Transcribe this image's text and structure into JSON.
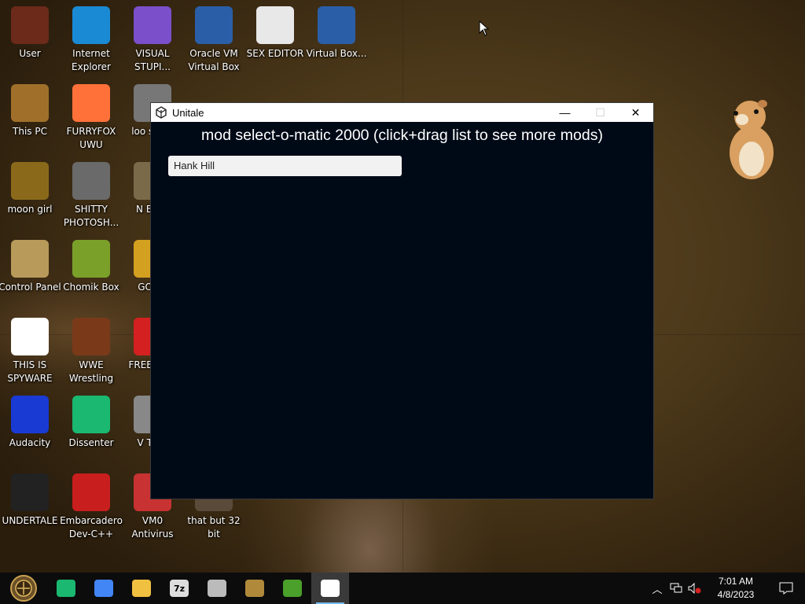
{
  "desktop": {
    "icons": [
      {
        "label": "User",
        "color": "#6b2a1a"
      },
      {
        "label": "Internet Explorer",
        "color": "#1a8ad4"
      },
      {
        "label": "VISUAL STUPI...",
        "color": "#7b4fc9"
      },
      {
        "label": "Oracle VM Virtual Box",
        "color": "#2a5fa8"
      },
      {
        "label": "SEX EDITOR",
        "color": "#e8e8e8"
      },
      {
        "label": "Virtual Box...",
        "color": "#2a5fa8"
      },
      {
        "label": "This PC",
        "color": "#a0702a"
      },
      {
        "label": "FURRYFOX UWU",
        "color": "#ff7139"
      },
      {
        "label": "loo skidd",
        "color": "#777777"
      },
      {
        "label": "moon girl",
        "color": "#8a6a1a"
      },
      {
        "label": "SHITTY PHOTOSH...",
        "color": "#6a6a6a"
      },
      {
        "label": "N Back",
        "color": "#7a6a4a"
      },
      {
        "label": "Control Panel",
        "color": "#b89a5a"
      },
      {
        "label": "Chomik Box",
        "color": "#7aa02a"
      },
      {
        "label": "GO Wi",
        "color": "#d4a020"
      },
      {
        "label": "THIS IS SPYWARE",
        "color": "#ffffff"
      },
      {
        "label": "WWE Wrestling",
        "color": "#7a3a1a"
      },
      {
        "label": "FREE GIFT",
        "color": "#d42020"
      },
      {
        "label": "Audacity",
        "color": "#1a3ad4"
      },
      {
        "label": "Dissenter",
        "color": "#1ab870"
      },
      {
        "label": "V Tech",
        "color": "#888888"
      },
      {
        "label": "UNDERTALE",
        "color": "#222222"
      },
      {
        "label": "Embarcadero Dev-C++",
        "color": "#c81e1e"
      },
      {
        "label": "VM0 Antivirus",
        "color": "#c83232"
      },
      {
        "label": "that but 32 bit",
        "color": "#5a4a3a"
      }
    ]
  },
  "window": {
    "title": "Unitale",
    "minimize_glyph": "—",
    "maximize_glyph": "☐",
    "close_glyph": "✕",
    "heading": "mod select-o-matic 2000 (click+drag list to see more mods)",
    "mod_entry": "Hank Hill",
    "background": "#000a17"
  },
  "taskbar": {
    "apps": [
      {
        "name": "dissenter-icon",
        "color": "#1ab870"
      },
      {
        "name": "chrome-icon",
        "color": "#4285f4"
      },
      {
        "name": "file-explorer-icon",
        "color": "#f0c040"
      },
      {
        "name": "7zip-icon",
        "color": "#dddddd",
        "text": "7z"
      },
      {
        "name": "disk-tool-icon",
        "color": "#bbbbbb"
      },
      {
        "name": "undertale-shortcut-icon",
        "color": "#b08a3a"
      },
      {
        "name": "chart-app-icon",
        "color": "#4aa02a"
      },
      {
        "name": "unity-icon",
        "color": "#ffffff"
      }
    ],
    "time": "7:01 AM",
    "date": "4/8/2023"
  }
}
